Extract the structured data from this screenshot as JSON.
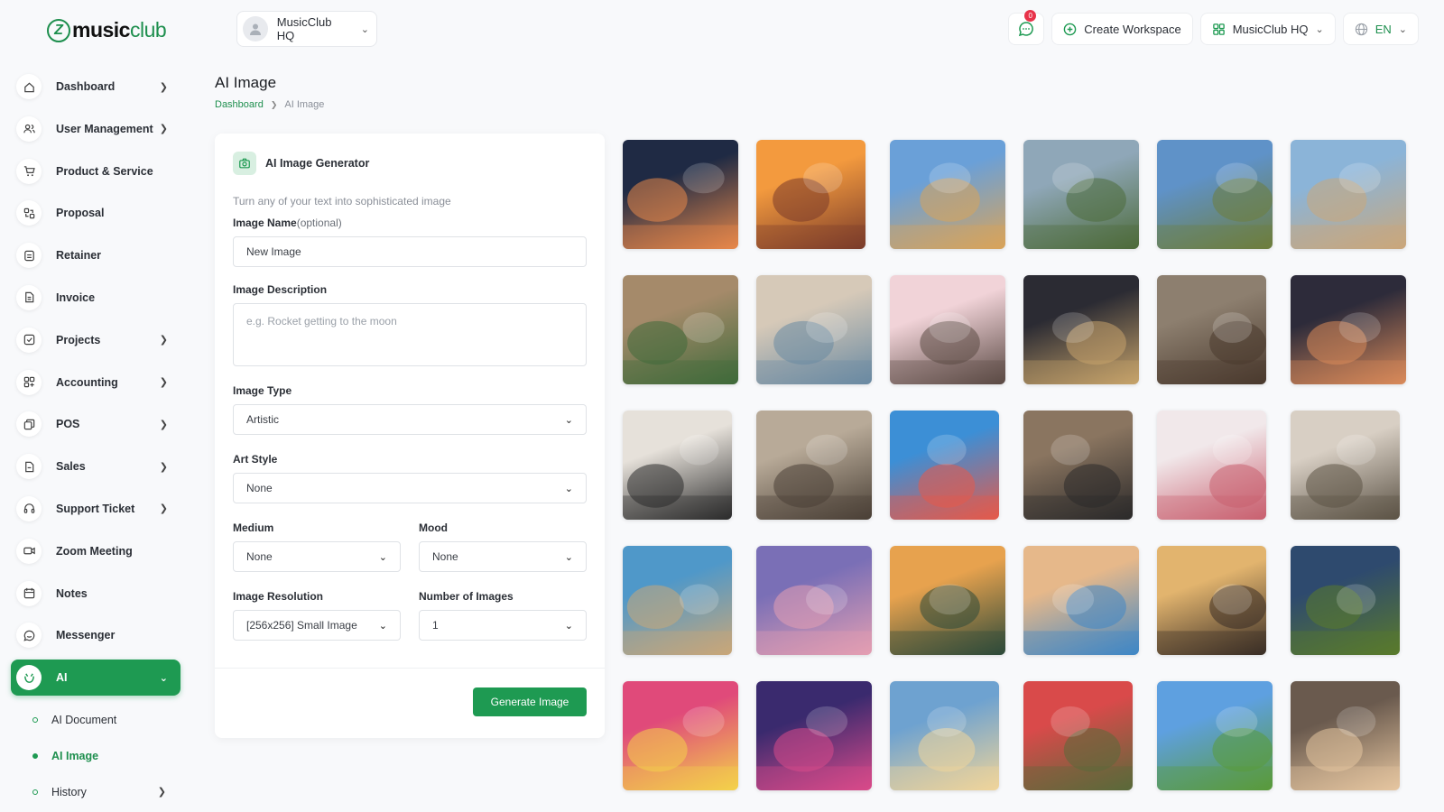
{
  "logo": {
    "bold": "music",
    "light": "club",
    "mark": "Z"
  },
  "workspace_switch": {
    "label": "MusicClub HQ"
  },
  "topbar": {
    "notifications": "0",
    "create_workspace": "Create Workspace",
    "workspace": "MusicClub HQ",
    "language": "EN"
  },
  "sidebar": {
    "items": [
      {
        "label": "Dashboard",
        "icon": "home-icon",
        "arrow": true
      },
      {
        "label": "User Management",
        "icon": "users-icon",
        "arrow": true
      },
      {
        "label": "Product & Service",
        "icon": "cart-icon",
        "arrow": false
      },
      {
        "label": "Proposal",
        "icon": "proposal-icon",
        "arrow": false
      },
      {
        "label": "Retainer",
        "icon": "retainer-icon",
        "arrow": false
      },
      {
        "label": "Invoice",
        "icon": "invoice-icon",
        "arrow": false
      },
      {
        "label": "Projects",
        "icon": "projects-icon",
        "arrow": true
      },
      {
        "label": "Accounting",
        "icon": "accounting-icon",
        "arrow": true
      },
      {
        "label": "POS",
        "icon": "pos-icon",
        "arrow": true
      },
      {
        "label": "Sales",
        "icon": "sales-icon",
        "arrow": true
      },
      {
        "label": "Support Ticket",
        "icon": "headset-icon",
        "arrow": true
      },
      {
        "label": "Zoom Meeting",
        "icon": "video-icon",
        "arrow": false
      },
      {
        "label": "Notes",
        "icon": "notes-icon",
        "arrow": false
      },
      {
        "label": "Messenger",
        "icon": "chat-icon",
        "arrow": false
      },
      {
        "label": "AI",
        "icon": "ai-icon",
        "arrow": true,
        "active": true
      }
    ],
    "sub_items": [
      {
        "label": "AI Document"
      },
      {
        "label": "AI Image",
        "current": true
      },
      {
        "label": "History",
        "arrow": true
      }
    ]
  },
  "page": {
    "title": "AI Image",
    "breadcrumb": {
      "home": "Dashboard",
      "current": "AI Image"
    }
  },
  "form": {
    "title": "AI Image Generator",
    "subtitle": "Turn any of your text into sophisticated image",
    "image_name_label": "Image Name",
    "image_name_optional": "(optional)",
    "image_name_value": "New Image",
    "description_label": "Image Description",
    "description_placeholder": "e.g. Rocket getting to the moon",
    "type_label": "Image Type",
    "type_value": "Artistic",
    "art_style_label": "Art Style",
    "art_style_value": "None",
    "medium_label": "Medium",
    "medium_value": "None",
    "mood_label": "Mood",
    "mood_value": "None",
    "resolution_label": "Image Resolution",
    "resolution_value": "[256x256] Small Image",
    "count_label": "Number of Images",
    "count_value": "1",
    "generate_button": "Generate Image"
  },
  "gallery": {
    "rows": [
      [
        "statue-of-liberty",
        "taj-mahal",
        "pyramids",
        "machu-picchu",
        "great-wall",
        "world-landmarks"
      ],
      [
        "child-playing",
        "friends-hug",
        "pink-cake",
        "sparklers-toast",
        "woman-sitting",
        "party-lights"
      ],
      [
        "women-laughing",
        "wedding-couple",
        "beach-joy",
        "woman-excited",
        "heart-wreath",
        "rocky-coast"
      ],
      [
        "tropical-beach",
        "sunset-pier",
        "palm-sunset",
        "beach-umbrellas",
        "butterfly-jar",
        "lone-tree"
      ],
      [
        "holi-colors",
        "stage-performance",
        "flower-girl",
        "rose-bouquet",
        "green-meadow",
        "guitar-friends"
      ]
    ],
    "palettes": [
      [
        [
          "#1f2a44",
          "#e7884a"
        ],
        [
          "#f39a3e",
          "#7a3b2a"
        ],
        [
          "#6aa0d8",
          "#d9a45a"
        ],
        [
          "#8fa7b8",
          "#4d6b3a"
        ],
        [
          "#5f92c8",
          "#6e7d3c"
        ],
        [
          "#8bb4d8",
          "#caa77a"
        ]
      ],
      [
        [
          "#a58a6a",
          "#3f6a3a"
        ],
        [
          "#d6c9b8",
          "#6a8aa2"
        ],
        [
          "#f1d3d8",
          "#5b4a44"
        ],
        [
          "#2b2b33",
          "#c7a36b"
        ],
        [
          "#8d7f6f",
          "#4a3a2e"
        ],
        [
          "#2d2b3a",
          "#d98a5a"
        ]
      ],
      [
        [
          "#e6e1da",
          "#2c2c2c"
        ],
        [
          "#b8aa98",
          "#4a4036"
        ],
        [
          "#3c8fd6",
          "#e55a4a"
        ],
        [
          "#8a7560",
          "#2c2a2a"
        ],
        [
          "#f1e8ea",
          "#c96070"
        ],
        [
          "#d8cfc4",
          "#5c5346"
        ]
      ],
      [
        [
          "#4f98c9",
          "#c9a779"
        ],
        [
          "#7a6fb6",
          "#e49fb2"
        ],
        [
          "#e7a24e",
          "#2d4a3a"
        ],
        [
          "#e6b88a",
          "#3f87c6"
        ],
        [
          "#e2b46e",
          "#3a2e26"
        ],
        [
          "#2e4a6e",
          "#5a7a2c"
        ]
      ],
      [
        [
          "#e04a7a",
          "#f4d24a"
        ],
        [
          "#3a2a6e",
          "#d94a8a"
        ],
        [
          "#6ea2d0",
          "#f0d59a"
        ],
        [
          "#d94a4a",
          "#5a6a3a"
        ],
        [
          "#5ea0e0",
          "#5a9a3a"
        ],
        [
          "#6a5a4e",
          "#e6c6a0"
        ]
      ]
    ]
  }
}
